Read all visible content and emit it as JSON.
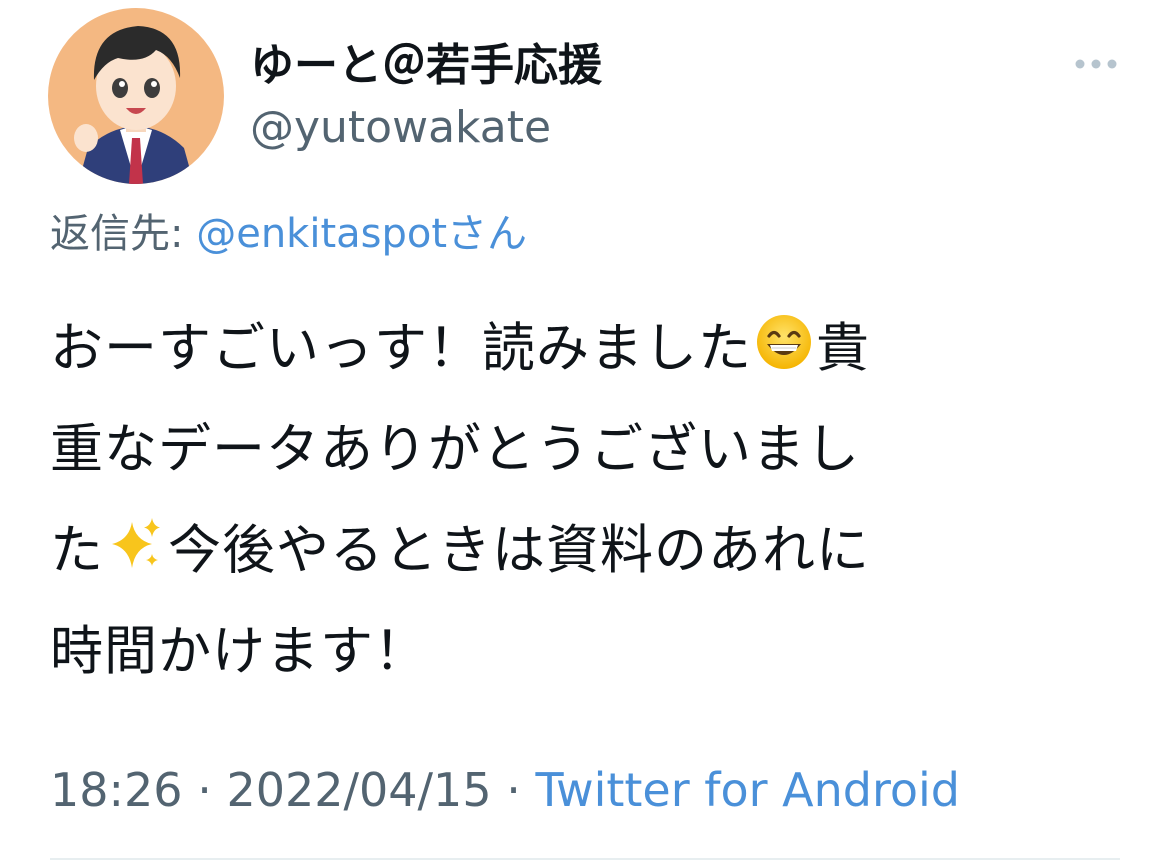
{
  "user": {
    "display_name": "ゆーと＠若手応援",
    "handle": "@yutowakate"
  },
  "reply": {
    "prefix": "返信先: ",
    "mention": "@enkitaspot",
    "suffix": "さん"
  },
  "tweet": {
    "line1_a": "おーすごいっす！読みました",
    "line1_b": "貴",
    "line2": "重なデータありがとうございまし",
    "line3_a": "た",
    "line3_b": "今後やるときは資料のあれに",
    "line4": "時間かけます！"
  },
  "meta": {
    "time": "18:26",
    "sep1": " · ",
    "date": "2022/04/15",
    "sep2": " · ",
    "source": "Twitter for Android"
  },
  "icons": {
    "more": "more-horizontal-icon",
    "emoji1": "grinning-face-with-smiling-eyes",
    "emoji2": "sparkles"
  },
  "colors": {
    "text": "#0f1419",
    "secondary": "#536471",
    "link": "#4a90d9",
    "avatar_bg": "#f4b882"
  }
}
